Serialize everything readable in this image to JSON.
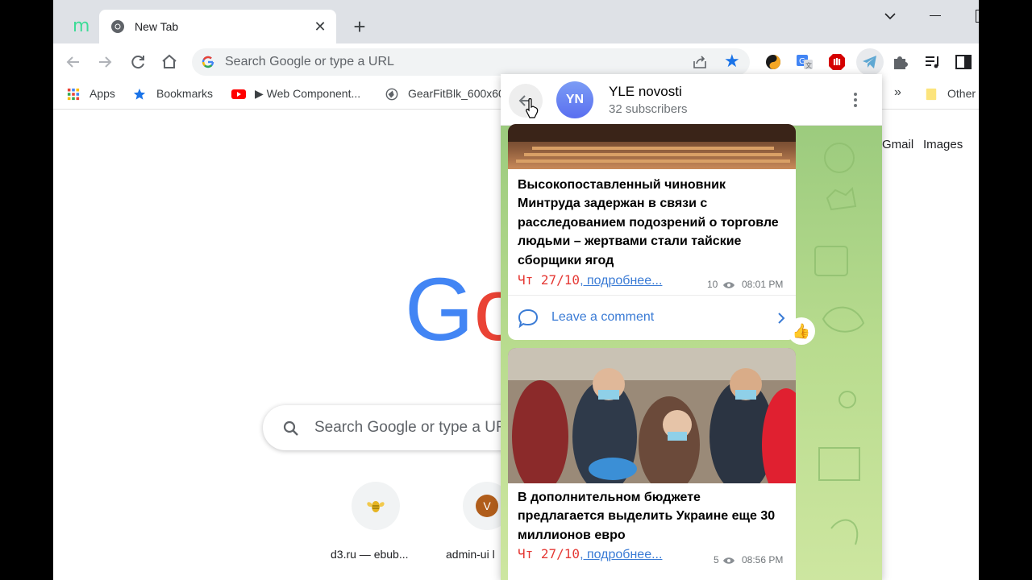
{
  "browser": {
    "tab_logo": "m",
    "tab_title": "New Tab",
    "tab_close": "✕",
    "new_tab": "+",
    "omnibox_placeholder": "Search Google or type a URL"
  },
  "bookmarks": {
    "apps": "Apps",
    "bookmarks": "Bookmarks",
    "web_components": "▶ Web Component...",
    "gearfit": "GearFitBlk_600x60",
    "more": "»",
    "other": "Other"
  },
  "newtab": {
    "gmail": "Gmail",
    "images": "Images",
    "logo_g": "G",
    "logo_o": "o",
    "search_placeholder": "Search Google or type a URL",
    "shortcuts": [
      {
        "label": "d3.ru — ebub...",
        "icon": "bee-icon"
      },
      {
        "label": "admin-ui l",
        "letter": "V"
      }
    ]
  },
  "telegram": {
    "avatar_initials": "YN",
    "channel_name": "YLE novosti",
    "subscribers": "32 subscribers",
    "messages": [
      {
        "text": "Высокопоставленный чиновник Минтруда задержан в связи с расследованием подозрений о торговле людьми – жертвами стали тайские сборщики ягод",
        "date": "Чт 27/10",
        "more": ", подробнее...",
        "views": "10",
        "time": "08:01 PM",
        "comment_label": "Leave a comment",
        "reaction": "👍"
      },
      {
        "text": "В дополнительном бюджете предлагается выделить Украине еще 30 миллионов евро",
        "date": "Чт 27/10",
        "more": ", подробнее...",
        "views": "5",
        "time": "08:56 PM"
      }
    ]
  }
}
